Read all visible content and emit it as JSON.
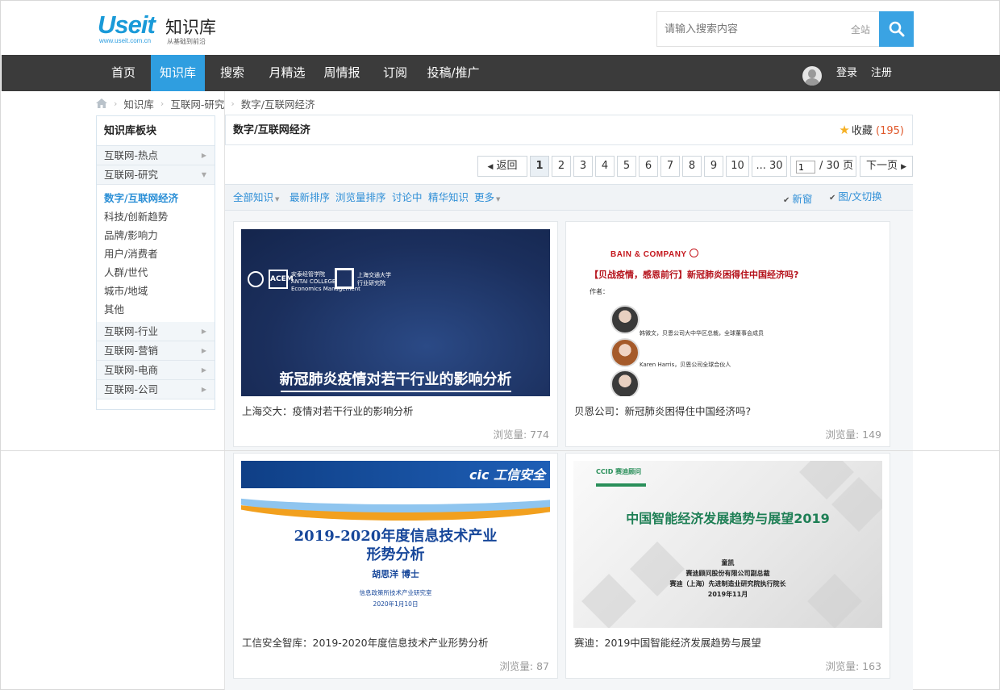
{
  "header": {
    "logo_mark": "Useit",
    "logo_url": "www.useit.com.cn",
    "logo_name": "知识库",
    "logo_sub": "从基础到前沿",
    "search_placeholder": "请输入搜索内容",
    "search_scope": "全站"
  },
  "nav": {
    "items": [
      "首页",
      "知识库",
      "搜索",
      "月精选",
      "周情报",
      "订阅",
      "投稿/推广"
    ],
    "active_index": 1,
    "login": "登录",
    "register": "注册"
  },
  "breadcrumb": [
    "知识库",
    "互联网-研究",
    "数字/互联网经济"
  ],
  "sidebar": {
    "title": "知识库板块",
    "groups_top": [
      "互联网-热点",
      "互联网-研究"
    ],
    "subs": [
      "数字/互联网经济",
      "科技/创新趋势",
      "品牌/影响力",
      "用户/消费者",
      "人群/世代",
      "城市/地域",
      "其他"
    ],
    "groups_bottom": [
      "互联网-行业",
      "互联网-营销",
      "互联网-电商",
      "互联网-公司"
    ]
  },
  "main": {
    "title": "数字/互联网经济",
    "fav_label": "收藏",
    "fav_count": "(195)"
  },
  "pager": {
    "back": "返回",
    "pages": [
      "1",
      "2",
      "3",
      "4",
      "5",
      "6",
      "7",
      "8",
      "9",
      "10"
    ],
    "ellipsis_last": "... 30",
    "input_value": "1",
    "total": "/ 30 页",
    "next": "下一页"
  },
  "filters": {
    "all": "全部知识",
    "newest": "最新排序",
    "views": "浏览量排序",
    "discuss": "讨论中",
    "featured": "精华知识",
    "more": "更多",
    "new_window": "新窗",
    "toggle": "图/文切换"
  },
  "cards": [
    {
      "title": "上海交大：疫情对若干行业的影响分析",
      "views": "浏览量: 774",
      "thumb_heading": "新冠肺炎疫情对若干行业的影响分析"
    },
    {
      "title": "贝恩公司：新冠肺炎困得住中国经济吗?",
      "views": "浏览量: 149",
      "thumb_brand": "BAIN & COMPANY",
      "thumb_heading": "【贝战疫情，感恩前行】新冠肺炎困得住中国经济吗?",
      "thumb_author_label": "作者：",
      "thumb_names": [
        "韩微文，贝恩公司大中华区总裁，全球董事会成员",
        "Karen Harris，贝恩公司全球合伙人"
      ]
    },
    {
      "title": "工信安全智库：2019-2020年度信息技术产业形势分析",
      "views": "浏览量: 87",
      "thumb_brand": "cic 工信安全",
      "thumb_heading_1": "2019-2020年度信息技术产业",
      "thumb_heading_2": "形势分析",
      "thumb_author": "胡思洋  博士",
      "thumb_dept": "信息政策所技术产业研究室",
      "thumb_date": "2020年1月10日"
    },
    {
      "title": "赛迪：2019中国智能经济发展趋势与展望",
      "views": "浏览量: 163",
      "thumb_brand": "CCID 赛迪顾问",
      "thumb_heading": "中国智能经济发展趋势与展望2019",
      "thumb_lines": [
        "童凯",
        "赛迪顾问股份有限公司副总裁",
        "赛迪（上海）先进制造业研究院执行院长",
        "2019年11月"
      ]
    }
  ]
}
